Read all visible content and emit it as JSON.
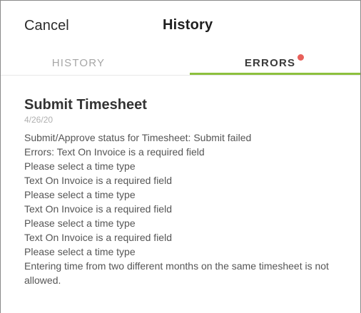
{
  "nav": {
    "cancel_label": "Cancel",
    "title": "History"
  },
  "tabs": [
    {
      "label": "HISTORY",
      "active": false
    },
    {
      "label": "ERRORS",
      "active": true,
      "has_badge": true
    }
  ],
  "colors": {
    "accent": "#8dc03e",
    "badge": "#e8605a"
  },
  "entry": {
    "title": "Submit Timesheet",
    "date": "4/26/20",
    "messages": [
      "Submit/Approve status for Timesheet: Submit failed",
      "Errors: Text On Invoice is a required field",
      "Please select a time type",
      "Text On Invoice is a required field",
      "Please select a time type",
      "Text On Invoice is a required field",
      "Please select a time type",
      "Text On Invoice is a required field",
      "Please select a time type",
      "Entering time from two different months on the same timesheet is not allowed."
    ]
  }
}
